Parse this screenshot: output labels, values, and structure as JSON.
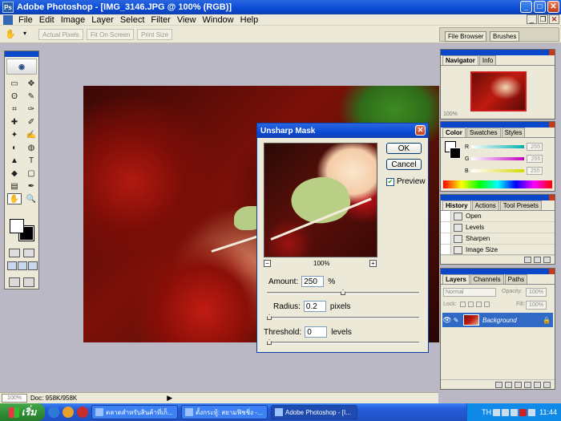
{
  "window": {
    "title": "Adobe Photoshop - [IMG_3146.JPG @ 100% (RGB)]",
    "minimize": "_",
    "maximize": "□",
    "close": "✕"
  },
  "menu": {
    "items": [
      "File",
      "Edit",
      "Image",
      "Layer",
      "Select",
      "Filter",
      "View",
      "Window",
      "Help"
    ]
  },
  "options_bar": {
    "tool_icon": "hand-icon",
    "buttons": [
      "Actual Pixels",
      "Fit On Screen",
      "Print Size"
    ],
    "palette_well_tabs": [
      "File Browser",
      "Brushes"
    ]
  },
  "toolbox": {
    "tools": [
      "▭",
      "✥",
      "ʘ",
      "✎",
      "⌗",
      "✑",
      "✚",
      "✐",
      "✦",
      "✍",
      "◐",
      "◍",
      "▲",
      "T",
      "◆",
      "▢",
      "▤",
      "✒",
      "✋",
      "🔍"
    ]
  },
  "dialog": {
    "title": "Unsharp Mask",
    "ok_label": "OK",
    "cancel_label": "Cancel",
    "preview_label": "Preview",
    "preview_checked": true,
    "zoom_label": "100%",
    "zoom_minus": "−",
    "zoom_plus": "+",
    "amount_label": "Amount:",
    "amount_value": "250",
    "amount_unit": "%",
    "amount_fraction": 0.5,
    "radius_label": "Radius:",
    "radius_value": "0.2",
    "radius_unit": "pixels",
    "radius_fraction": 0.0,
    "threshold_label": "Threshold:",
    "threshold_value": "0",
    "threshold_unit": "levels",
    "threshold_fraction": 0.0
  },
  "navigator": {
    "tabs": [
      "Navigator",
      "Info"
    ],
    "zoom": "100%"
  },
  "color_panel": {
    "tabs": [
      "Color",
      "Swatches",
      "Styles"
    ],
    "channels": [
      {
        "label": "R",
        "value": "255",
        "color": "#00b0b0"
      },
      {
        "label": "G",
        "value": "255",
        "color": "#c000c0"
      },
      {
        "label": "B",
        "value": "255",
        "color": "#d8d800"
      }
    ]
  },
  "history_panel": {
    "tabs": [
      "History",
      "Actions",
      "Tool Presets"
    ],
    "items": [
      "Open",
      "Levels",
      "Sharpen",
      "Image Size"
    ]
  },
  "layers_panel": {
    "tabs": [
      "Layers",
      "Channels",
      "Paths"
    ],
    "blend_mode": "Normal",
    "opacity_label": "Opacity:",
    "opacity_value": "100%",
    "lock_label": "Lock:",
    "fill_label": "Fill:",
    "fill_value": "100%",
    "layer_name": "Background"
  },
  "status_bar": {
    "zoom": "100%",
    "doc_info": "Doc: 958K/958K"
  },
  "taskbar": {
    "start_label": "เริ่ม",
    "tasks": [
      {
        "label": "ตลาดสำหรับสินค้าที่เก็...",
        "active": false
      },
      {
        "label": "ตั้งกระทู้: สยามฟิชชิ่ง -...",
        "active": false
      },
      {
        "label": "Adobe Photoshop - [I...",
        "active": true
      }
    ],
    "language": "TH",
    "clock": "11:44"
  }
}
